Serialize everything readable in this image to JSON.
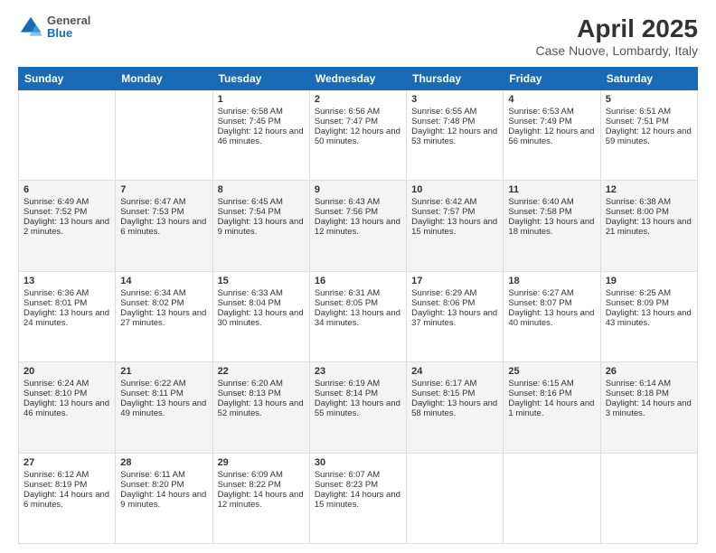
{
  "header": {
    "logo": {
      "general": "General",
      "blue": "Blue"
    },
    "title": "April 2025",
    "location": "Case Nuove, Lombardy, Italy"
  },
  "columns": [
    "Sunday",
    "Monday",
    "Tuesday",
    "Wednesday",
    "Thursday",
    "Friday",
    "Saturday"
  ],
  "weeks": [
    [
      {
        "day": "",
        "info": ""
      },
      {
        "day": "",
        "info": ""
      },
      {
        "day": "1",
        "info": "Sunrise: 6:58 AM\nSunset: 7:45 PM\nDaylight: 12 hours and 46 minutes."
      },
      {
        "day": "2",
        "info": "Sunrise: 6:56 AM\nSunset: 7:47 PM\nDaylight: 12 hours and 50 minutes."
      },
      {
        "day": "3",
        "info": "Sunrise: 6:55 AM\nSunset: 7:48 PM\nDaylight: 12 hours and 53 minutes."
      },
      {
        "day": "4",
        "info": "Sunrise: 6:53 AM\nSunset: 7:49 PM\nDaylight: 12 hours and 56 minutes."
      },
      {
        "day": "5",
        "info": "Sunrise: 6:51 AM\nSunset: 7:51 PM\nDaylight: 12 hours and 59 minutes."
      }
    ],
    [
      {
        "day": "6",
        "info": "Sunrise: 6:49 AM\nSunset: 7:52 PM\nDaylight: 13 hours and 2 minutes."
      },
      {
        "day": "7",
        "info": "Sunrise: 6:47 AM\nSunset: 7:53 PM\nDaylight: 13 hours and 6 minutes."
      },
      {
        "day": "8",
        "info": "Sunrise: 6:45 AM\nSunset: 7:54 PM\nDaylight: 13 hours and 9 minutes."
      },
      {
        "day": "9",
        "info": "Sunrise: 6:43 AM\nSunset: 7:56 PM\nDaylight: 13 hours and 12 minutes."
      },
      {
        "day": "10",
        "info": "Sunrise: 6:42 AM\nSunset: 7:57 PM\nDaylight: 13 hours and 15 minutes."
      },
      {
        "day": "11",
        "info": "Sunrise: 6:40 AM\nSunset: 7:58 PM\nDaylight: 13 hours and 18 minutes."
      },
      {
        "day": "12",
        "info": "Sunrise: 6:38 AM\nSunset: 8:00 PM\nDaylight: 13 hours and 21 minutes."
      }
    ],
    [
      {
        "day": "13",
        "info": "Sunrise: 6:36 AM\nSunset: 8:01 PM\nDaylight: 13 hours and 24 minutes."
      },
      {
        "day": "14",
        "info": "Sunrise: 6:34 AM\nSunset: 8:02 PM\nDaylight: 13 hours and 27 minutes."
      },
      {
        "day": "15",
        "info": "Sunrise: 6:33 AM\nSunset: 8:04 PM\nDaylight: 13 hours and 30 minutes."
      },
      {
        "day": "16",
        "info": "Sunrise: 6:31 AM\nSunset: 8:05 PM\nDaylight: 13 hours and 34 minutes."
      },
      {
        "day": "17",
        "info": "Sunrise: 6:29 AM\nSunset: 8:06 PM\nDaylight: 13 hours and 37 minutes."
      },
      {
        "day": "18",
        "info": "Sunrise: 6:27 AM\nSunset: 8:07 PM\nDaylight: 13 hours and 40 minutes."
      },
      {
        "day": "19",
        "info": "Sunrise: 6:25 AM\nSunset: 8:09 PM\nDaylight: 13 hours and 43 minutes."
      }
    ],
    [
      {
        "day": "20",
        "info": "Sunrise: 6:24 AM\nSunset: 8:10 PM\nDaylight: 13 hours and 46 minutes."
      },
      {
        "day": "21",
        "info": "Sunrise: 6:22 AM\nSunset: 8:11 PM\nDaylight: 13 hours and 49 minutes."
      },
      {
        "day": "22",
        "info": "Sunrise: 6:20 AM\nSunset: 8:13 PM\nDaylight: 13 hours and 52 minutes."
      },
      {
        "day": "23",
        "info": "Sunrise: 6:19 AM\nSunset: 8:14 PM\nDaylight: 13 hours and 55 minutes."
      },
      {
        "day": "24",
        "info": "Sunrise: 6:17 AM\nSunset: 8:15 PM\nDaylight: 13 hours and 58 minutes."
      },
      {
        "day": "25",
        "info": "Sunrise: 6:15 AM\nSunset: 8:16 PM\nDaylight: 14 hours and 1 minute."
      },
      {
        "day": "26",
        "info": "Sunrise: 6:14 AM\nSunset: 8:18 PM\nDaylight: 14 hours and 3 minutes."
      }
    ],
    [
      {
        "day": "27",
        "info": "Sunrise: 6:12 AM\nSunset: 8:19 PM\nDaylight: 14 hours and 6 minutes."
      },
      {
        "day": "28",
        "info": "Sunrise: 6:11 AM\nSunset: 8:20 PM\nDaylight: 14 hours and 9 minutes."
      },
      {
        "day": "29",
        "info": "Sunrise: 6:09 AM\nSunset: 8:22 PM\nDaylight: 14 hours and 12 minutes."
      },
      {
        "day": "30",
        "info": "Sunrise: 6:07 AM\nSunset: 8:23 PM\nDaylight: 14 hours and 15 minutes."
      },
      {
        "day": "",
        "info": ""
      },
      {
        "day": "",
        "info": ""
      },
      {
        "day": "",
        "info": ""
      }
    ]
  ]
}
